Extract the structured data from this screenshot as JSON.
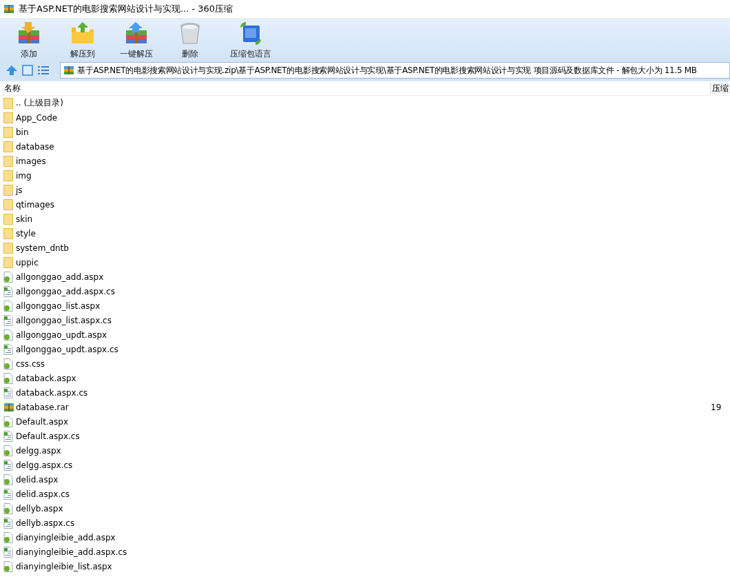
{
  "window": {
    "title": "基于ASP.NET的电影搜索网站设计与实现... - 360压缩"
  },
  "toolbar": [
    {
      "label": "添加",
      "kind": "add"
    },
    {
      "label": "解压到",
      "kind": "extract-to"
    },
    {
      "label": "一键解压",
      "kind": "extract"
    },
    {
      "label": "删除",
      "kind": "delete"
    },
    {
      "label": "压缩包语言",
      "kind": "language"
    }
  ],
  "address": {
    "value": "基于ASP.NET的电影搜索网站设计与实现.zip\\基于ASP.NET的电影搜索网站设计与实现\\基于ASP.NET的电影搜索网站设计与实现 项目源码及数据库文件 - 解包大小为 11.5 MB"
  },
  "table": {
    "columns": [
      "名称",
      "压缩"
    ],
    "rows": [
      {
        "name": ".. (上级目录)",
        "kind": "folder"
      },
      {
        "name": "App_Code",
        "kind": "folder"
      },
      {
        "name": "bin",
        "kind": "folder"
      },
      {
        "name": "database",
        "kind": "folder"
      },
      {
        "name": "images",
        "kind": "folder"
      },
      {
        "name": "img",
        "kind": "folder"
      },
      {
        "name": "js",
        "kind": "folder"
      },
      {
        "name": "qtimages",
        "kind": "folder"
      },
      {
        "name": "skin",
        "kind": "folder"
      },
      {
        "name": "style",
        "kind": "folder"
      },
      {
        "name": "system_dntb",
        "kind": "folder"
      },
      {
        "name": "uppic",
        "kind": "folder"
      },
      {
        "name": "allgonggao_add.aspx",
        "kind": "page"
      },
      {
        "name": "allgonggao_add.aspx.cs",
        "kind": "code"
      },
      {
        "name": "allgonggao_list.aspx",
        "kind": "page"
      },
      {
        "name": "allgonggao_list.aspx.cs",
        "kind": "code"
      },
      {
        "name": "allgonggao_updt.aspx",
        "kind": "page"
      },
      {
        "name": "allgonggao_updt.aspx.cs",
        "kind": "code"
      },
      {
        "name": "css.css",
        "kind": "page"
      },
      {
        "name": "databack.aspx",
        "kind": "page"
      },
      {
        "name": "databack.aspx.cs",
        "kind": "code"
      },
      {
        "name": "database.rar",
        "kind": "archive",
        "column_2": "19"
      },
      {
        "name": "Default.aspx",
        "kind": "page"
      },
      {
        "name": "Default.aspx.cs",
        "kind": "code"
      },
      {
        "name": "delgg.aspx",
        "kind": "page"
      },
      {
        "name": "delgg.aspx.cs",
        "kind": "code"
      },
      {
        "name": "delid.aspx",
        "kind": "page"
      },
      {
        "name": "delid.aspx.cs",
        "kind": "code"
      },
      {
        "name": "dellyb.aspx",
        "kind": "page"
      },
      {
        "name": "dellyb.aspx.cs",
        "kind": "code"
      },
      {
        "name": "dianyingleibie_add.aspx",
        "kind": "page"
      },
      {
        "name": "dianyingleibie_add.aspx.cs",
        "kind": "code"
      },
      {
        "name": "dianyingleibie_list.aspx",
        "kind": "page"
      }
    ]
  }
}
